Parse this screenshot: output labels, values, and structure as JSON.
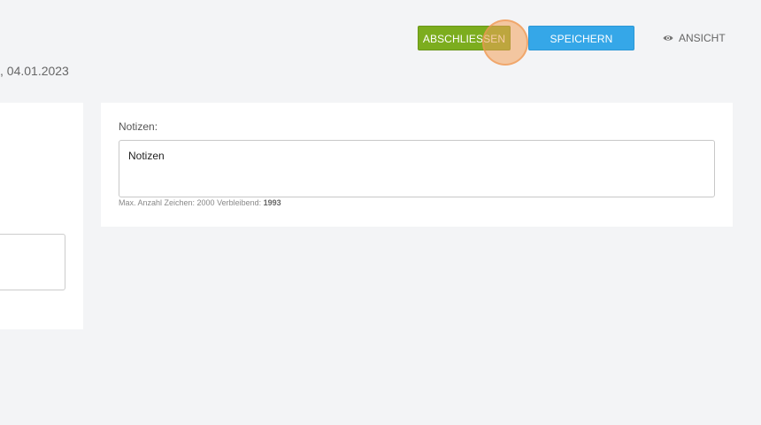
{
  "toolbar": {
    "complete_label": "ABSCHLIESSEN",
    "save_label": "SPEICHERN",
    "view_label": "ANSICHT",
    "complete_color": "#7cad1e",
    "save_color": "#35a7e8"
  },
  "header": {
    "date_text": ", 04.01.2023"
  },
  "notes": {
    "label": "Notizen:",
    "value": "Notizen",
    "char_info_prefix": "Max. Anzahl Zeichen: 2000 Verbleibend:",
    "remaining": "1993"
  },
  "icons": {
    "view": "eye-icon"
  }
}
